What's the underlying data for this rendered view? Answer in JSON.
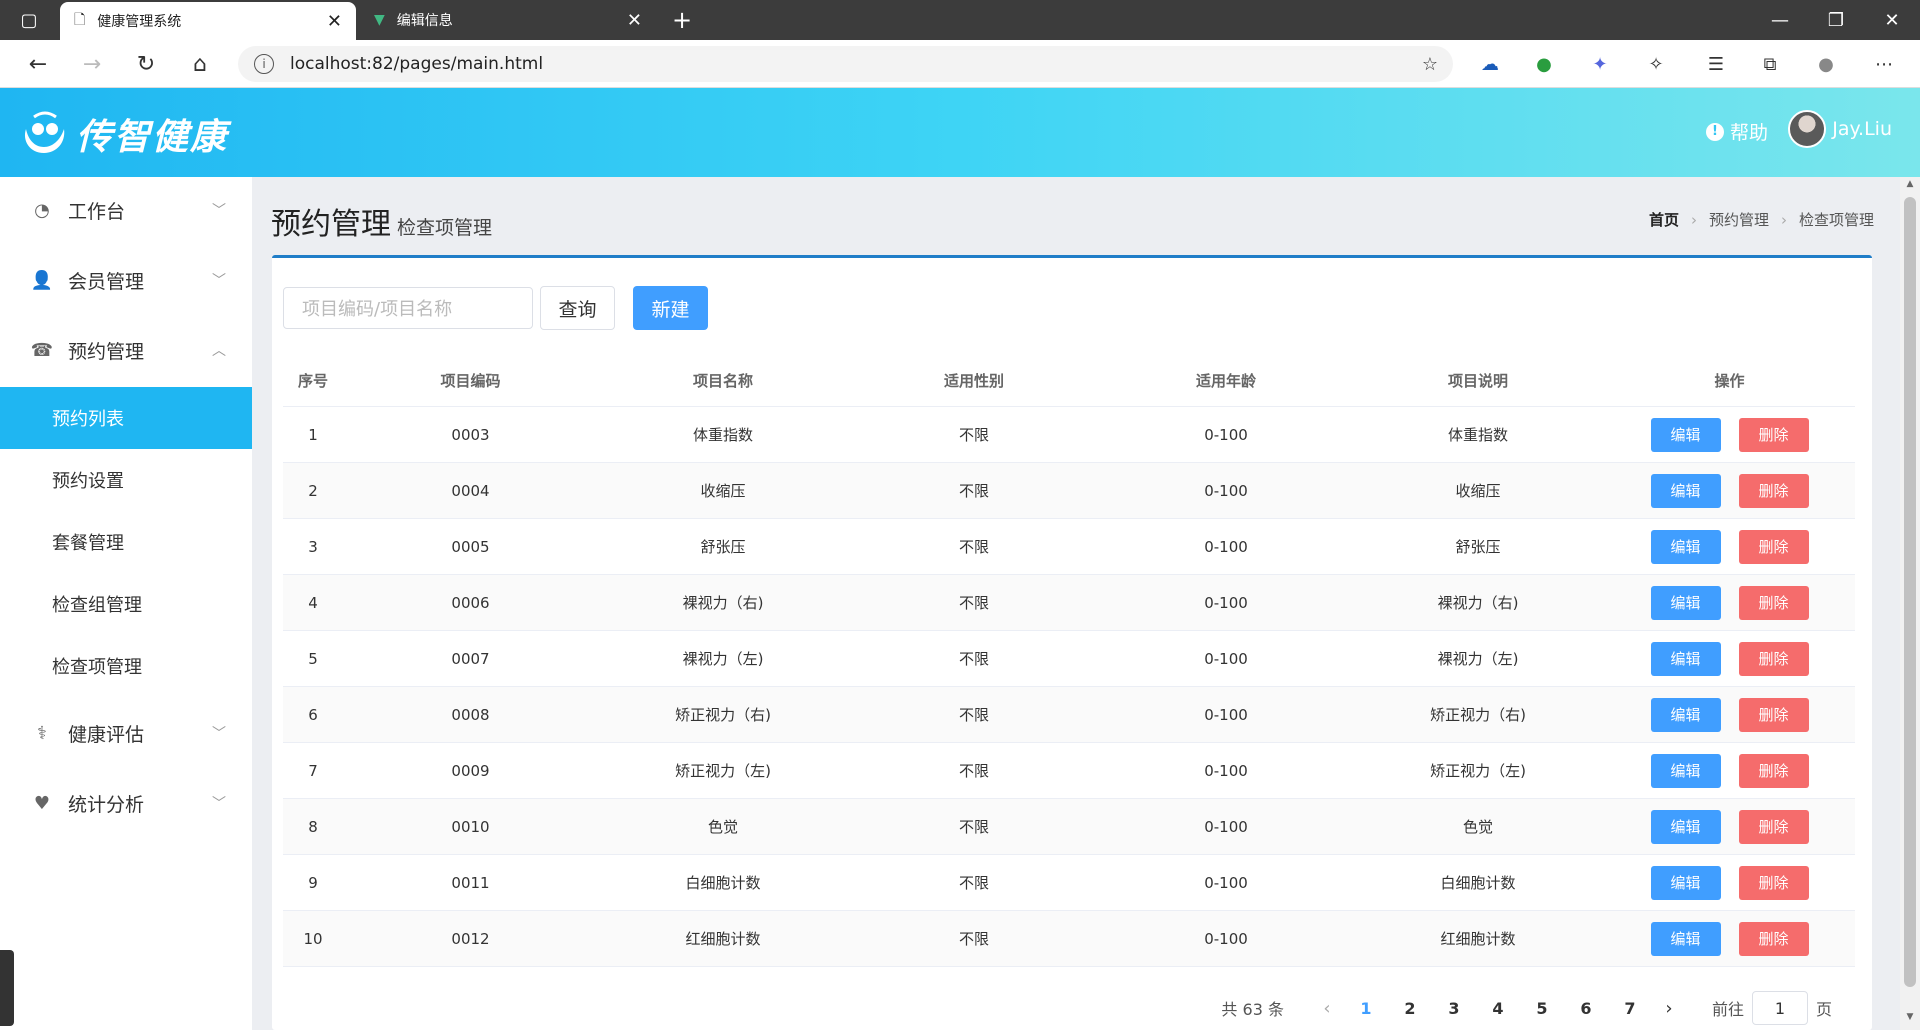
{
  "browser": {
    "tabs": [
      {
        "title": "健康管理系统",
        "active": true
      },
      {
        "title": "编辑信息",
        "active": false
      }
    ],
    "new_tab": "+",
    "url": "localhost:82/pages/main.html",
    "window_buttons": [
      "—",
      "❐",
      "✕"
    ]
  },
  "header": {
    "logo_text": "传智健康",
    "help_label": "帮助",
    "user_name": "Jay.Liu"
  },
  "sidebar": {
    "items": [
      {
        "label": "工作台",
        "icon": "dashboard-icon",
        "chevron": "﹀"
      },
      {
        "label": "会员管理",
        "icon": "user-icon",
        "chevron": "﹀"
      },
      {
        "label": "预约管理",
        "icon": "phone-icon",
        "chevron": "︿"
      },
      {
        "label": "健康评估",
        "icon": "stethoscope-icon",
        "chevron": "﹀"
      },
      {
        "label": "统计分析",
        "icon": "heartbeat-icon",
        "chevron": "﹀"
      }
    ],
    "subitems": [
      {
        "label": "预约列表",
        "active": true
      },
      {
        "label": "预约设置",
        "active": false
      },
      {
        "label": "套餐管理",
        "active": false
      },
      {
        "label": "检查组管理",
        "active": false
      },
      {
        "label": "检查项管理",
        "active": false
      }
    ]
  },
  "page": {
    "title": "预约管理",
    "subtitle": "检查项管理",
    "breadcrumb": [
      "首页",
      "预约管理",
      "检查项管理"
    ]
  },
  "toolbar": {
    "search_placeholder": "项目编码/项目名称",
    "query_label": "查询",
    "new_label": "新建"
  },
  "table": {
    "headers": [
      "序号",
      "项目编码",
      "项目名称",
      "适用性别",
      "适用年龄",
      "项目说明",
      "操作"
    ],
    "edit_label": "编辑",
    "delete_label": "删除",
    "rows": [
      [
        "1",
        "0003",
        "体重指数",
        "不限",
        "0-100",
        "体重指数"
      ],
      [
        "2",
        "0004",
        "收缩压",
        "不限",
        "0-100",
        "收缩压"
      ],
      [
        "3",
        "0005",
        "舒张压",
        "不限",
        "0-100",
        "舒张压"
      ],
      [
        "4",
        "0006",
        "裸视力（右)",
        "不限",
        "0-100",
        "裸视力（右)"
      ],
      [
        "5",
        "0007",
        "裸视力（左)",
        "不限",
        "0-100",
        "裸视力（左)"
      ],
      [
        "6",
        "0008",
        "矫正视力（右)",
        "不限",
        "0-100",
        "矫正视力（右)"
      ],
      [
        "7",
        "0009",
        "矫正视力（左)",
        "不限",
        "0-100",
        "矫正视力（左)"
      ],
      [
        "8",
        "0010",
        "色觉",
        "不限",
        "0-100",
        "色觉"
      ],
      [
        "9",
        "0011",
        "白细胞计数",
        "不限",
        "0-100",
        "白细胞计数"
      ],
      [
        "10",
        "0012",
        "红细胞计数",
        "不限",
        "0-100",
        "红细胞计数"
      ]
    ]
  },
  "pagination": {
    "total": "共 63 条",
    "pages": [
      "1",
      "2",
      "3",
      "4",
      "5",
      "6",
      "7"
    ],
    "current": "1",
    "goto_label": "前往",
    "goto_value": "1",
    "page_suffix": "页"
  },
  "colors": {
    "primary": "#409eff",
    "danger": "#f56c6c",
    "header_gradient_start": "#1fb6f2",
    "sidebar_active": "#1fb6f2"
  }
}
